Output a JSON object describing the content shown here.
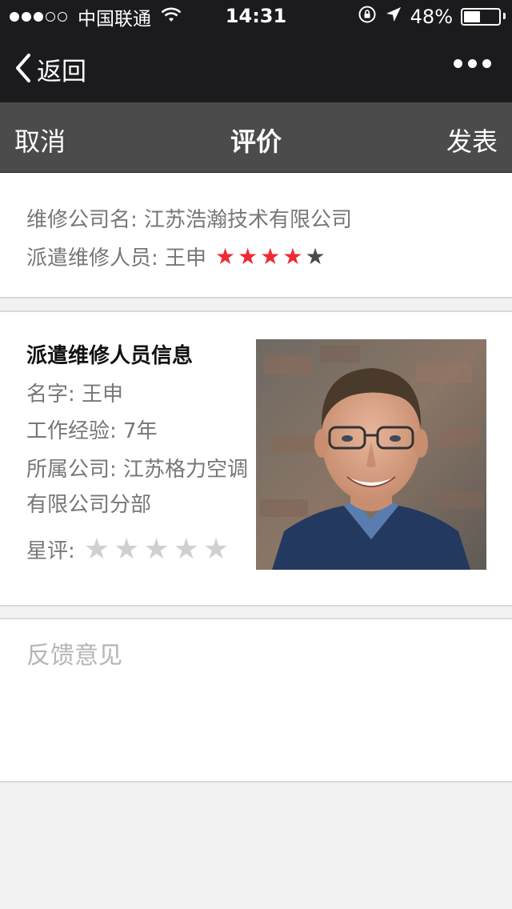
{
  "status_bar": {
    "signal_full": 3,
    "signal_total": 5,
    "carrier": "中国联通",
    "time": "14:31",
    "battery_text": "48%",
    "battery_level": 0.48
  },
  "nav": {
    "back_label": "返回"
  },
  "action_bar": {
    "cancel_label": "取消",
    "title": "评价",
    "publish_label": "发表"
  },
  "summary": {
    "company_line": "维修公司名: 江苏浩瀚技术有限公司",
    "staff_line": "派遣维修人员: 王申",
    "staff_rating": 4,
    "staff_rating_max": 5
  },
  "staff_info": {
    "title": "派遣维修人员信息",
    "name": "名字: 王申",
    "experience": "工作经验: 7年",
    "company": "所属公司: 江苏格力空调有限公司分部",
    "rating_label": "星评:",
    "rating": 0,
    "rating_max": 5
  },
  "feedback": {
    "placeholder": "反馈意见",
    "value": ""
  },
  "icons": {
    "back": "chevron-left-icon",
    "more": "more-dots-icon",
    "wifi": "wifi-icon",
    "lock_rotation": "rotation-lock-icon",
    "location": "location-arrow-icon",
    "star": "star-icon"
  },
  "colors": {
    "bar_dark": "#1b1b1e",
    "action_bar": "#4b4b4b",
    "star_filled": "#ee2a35",
    "star_empty_dark": "#4a4a4a",
    "star_empty_light": "#d0d0d0"
  }
}
